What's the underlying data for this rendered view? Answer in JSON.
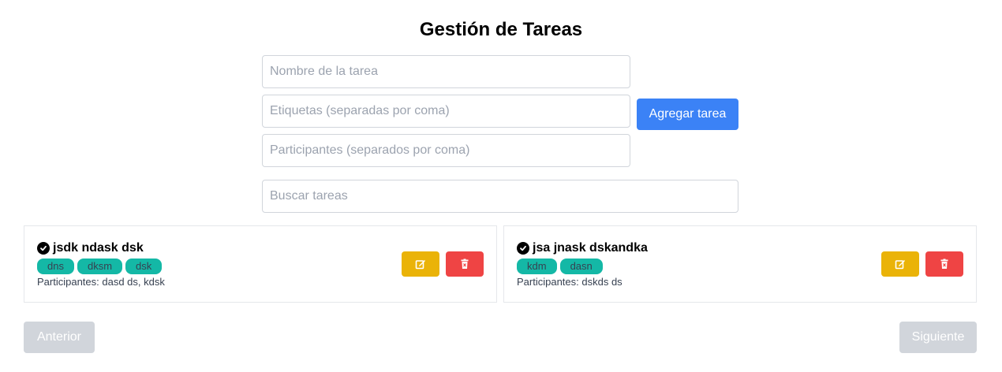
{
  "header": {
    "title": "Gestión de Tareas"
  },
  "form": {
    "name_placeholder": "Nombre de la tarea",
    "tags_placeholder": "Etiquetas (separadas por coma)",
    "participants_placeholder": "Participantes (separados por coma)",
    "add_label": "Agregar tarea",
    "add_color": "#3b82f6"
  },
  "search": {
    "placeholder": "Buscar tareas"
  },
  "tasks": [
    {
      "title": "jsdk ndask dsk",
      "tags": [
        "dns",
        "dksm",
        "dsk"
      ],
      "participants": "Participantes: dasd ds, kdsk",
      "edit_icon": "edit-icon",
      "delete_icon": "trash-icon"
    },
    {
      "title": "jsa jnask dskandka",
      "tags": [
        "kdm",
        "dasn"
      ],
      "participants": "Participantes: dskds ds",
      "edit_icon": "edit-icon",
      "delete_icon": "trash-icon"
    }
  ],
  "colors": {
    "tag": "#14b8a6",
    "edit": "#eab308",
    "delete": "#ef4444",
    "disabled": "#d1d5db"
  },
  "pagination": {
    "prev_label": "Anterior",
    "next_label": "Siguiente"
  }
}
